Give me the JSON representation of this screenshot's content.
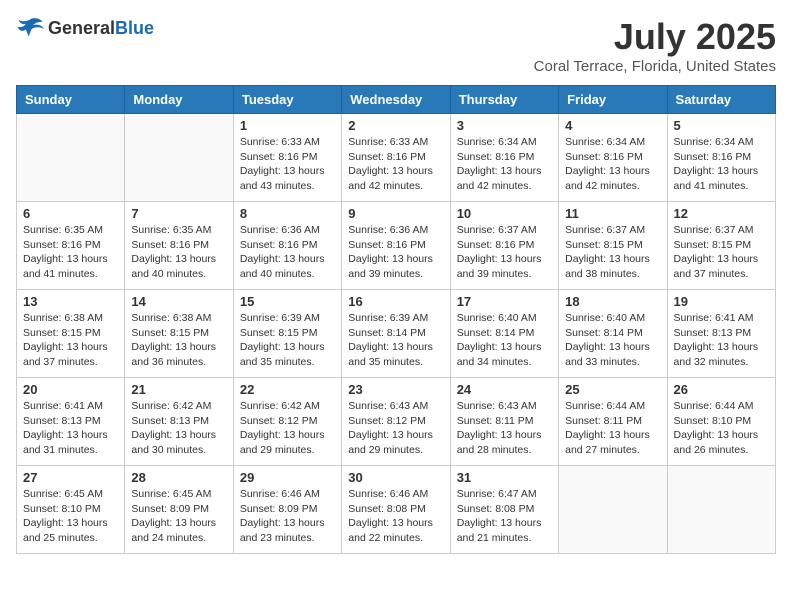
{
  "logo": {
    "general": "General",
    "blue": "Blue"
  },
  "title": "July 2025",
  "subtitle": "Coral Terrace, Florida, United States",
  "days_of_week": [
    "Sunday",
    "Monday",
    "Tuesday",
    "Wednesday",
    "Thursday",
    "Friday",
    "Saturday"
  ],
  "weeks": [
    [
      {
        "day": "",
        "info": ""
      },
      {
        "day": "",
        "info": ""
      },
      {
        "day": "1",
        "info": "Sunrise: 6:33 AM\nSunset: 8:16 PM\nDaylight: 13 hours and 43 minutes."
      },
      {
        "day": "2",
        "info": "Sunrise: 6:33 AM\nSunset: 8:16 PM\nDaylight: 13 hours and 42 minutes."
      },
      {
        "day": "3",
        "info": "Sunrise: 6:34 AM\nSunset: 8:16 PM\nDaylight: 13 hours and 42 minutes."
      },
      {
        "day": "4",
        "info": "Sunrise: 6:34 AM\nSunset: 8:16 PM\nDaylight: 13 hours and 42 minutes."
      },
      {
        "day": "5",
        "info": "Sunrise: 6:34 AM\nSunset: 8:16 PM\nDaylight: 13 hours and 41 minutes."
      }
    ],
    [
      {
        "day": "6",
        "info": "Sunrise: 6:35 AM\nSunset: 8:16 PM\nDaylight: 13 hours and 41 minutes."
      },
      {
        "day": "7",
        "info": "Sunrise: 6:35 AM\nSunset: 8:16 PM\nDaylight: 13 hours and 40 minutes."
      },
      {
        "day": "8",
        "info": "Sunrise: 6:36 AM\nSunset: 8:16 PM\nDaylight: 13 hours and 40 minutes."
      },
      {
        "day": "9",
        "info": "Sunrise: 6:36 AM\nSunset: 8:16 PM\nDaylight: 13 hours and 39 minutes."
      },
      {
        "day": "10",
        "info": "Sunrise: 6:37 AM\nSunset: 8:16 PM\nDaylight: 13 hours and 39 minutes."
      },
      {
        "day": "11",
        "info": "Sunrise: 6:37 AM\nSunset: 8:15 PM\nDaylight: 13 hours and 38 minutes."
      },
      {
        "day": "12",
        "info": "Sunrise: 6:37 AM\nSunset: 8:15 PM\nDaylight: 13 hours and 37 minutes."
      }
    ],
    [
      {
        "day": "13",
        "info": "Sunrise: 6:38 AM\nSunset: 8:15 PM\nDaylight: 13 hours and 37 minutes."
      },
      {
        "day": "14",
        "info": "Sunrise: 6:38 AM\nSunset: 8:15 PM\nDaylight: 13 hours and 36 minutes."
      },
      {
        "day": "15",
        "info": "Sunrise: 6:39 AM\nSunset: 8:15 PM\nDaylight: 13 hours and 35 minutes."
      },
      {
        "day": "16",
        "info": "Sunrise: 6:39 AM\nSunset: 8:14 PM\nDaylight: 13 hours and 35 minutes."
      },
      {
        "day": "17",
        "info": "Sunrise: 6:40 AM\nSunset: 8:14 PM\nDaylight: 13 hours and 34 minutes."
      },
      {
        "day": "18",
        "info": "Sunrise: 6:40 AM\nSunset: 8:14 PM\nDaylight: 13 hours and 33 minutes."
      },
      {
        "day": "19",
        "info": "Sunrise: 6:41 AM\nSunset: 8:13 PM\nDaylight: 13 hours and 32 minutes."
      }
    ],
    [
      {
        "day": "20",
        "info": "Sunrise: 6:41 AM\nSunset: 8:13 PM\nDaylight: 13 hours and 31 minutes."
      },
      {
        "day": "21",
        "info": "Sunrise: 6:42 AM\nSunset: 8:13 PM\nDaylight: 13 hours and 30 minutes."
      },
      {
        "day": "22",
        "info": "Sunrise: 6:42 AM\nSunset: 8:12 PM\nDaylight: 13 hours and 29 minutes."
      },
      {
        "day": "23",
        "info": "Sunrise: 6:43 AM\nSunset: 8:12 PM\nDaylight: 13 hours and 29 minutes."
      },
      {
        "day": "24",
        "info": "Sunrise: 6:43 AM\nSunset: 8:11 PM\nDaylight: 13 hours and 28 minutes."
      },
      {
        "day": "25",
        "info": "Sunrise: 6:44 AM\nSunset: 8:11 PM\nDaylight: 13 hours and 27 minutes."
      },
      {
        "day": "26",
        "info": "Sunrise: 6:44 AM\nSunset: 8:10 PM\nDaylight: 13 hours and 26 minutes."
      }
    ],
    [
      {
        "day": "27",
        "info": "Sunrise: 6:45 AM\nSunset: 8:10 PM\nDaylight: 13 hours and 25 minutes."
      },
      {
        "day": "28",
        "info": "Sunrise: 6:45 AM\nSunset: 8:09 PM\nDaylight: 13 hours and 24 minutes."
      },
      {
        "day": "29",
        "info": "Sunrise: 6:46 AM\nSunset: 8:09 PM\nDaylight: 13 hours and 23 minutes."
      },
      {
        "day": "30",
        "info": "Sunrise: 6:46 AM\nSunset: 8:08 PM\nDaylight: 13 hours and 22 minutes."
      },
      {
        "day": "31",
        "info": "Sunrise: 6:47 AM\nSunset: 8:08 PM\nDaylight: 13 hours and 21 minutes."
      },
      {
        "day": "",
        "info": ""
      },
      {
        "day": "",
        "info": ""
      }
    ]
  ]
}
